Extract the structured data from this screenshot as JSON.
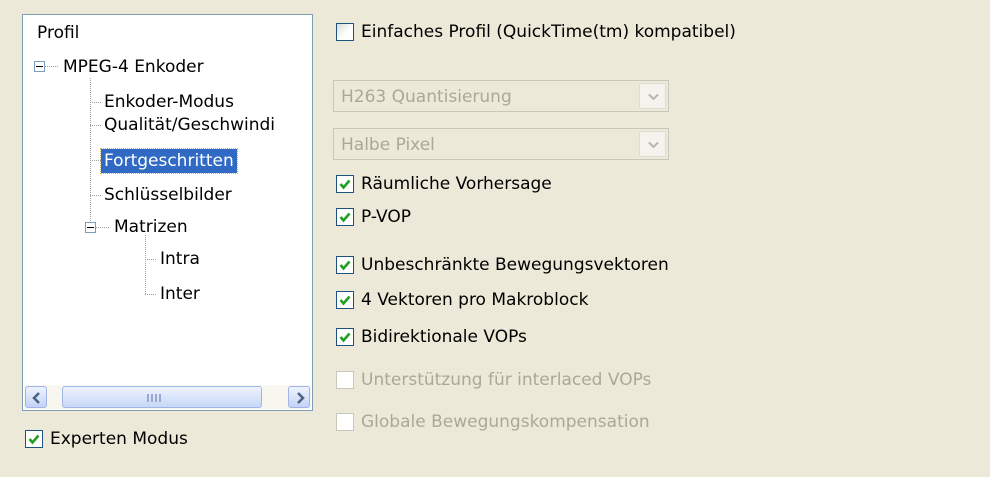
{
  "tree": {
    "nodes": [
      {
        "id": "profil",
        "label": "Profil"
      },
      {
        "id": "mpeg4",
        "label": "MPEG-4 Enkoder"
      },
      {
        "id": "enkoder_modus",
        "label": "Enkoder-Modus"
      },
      {
        "id": "qualitaet",
        "label": "Qualität/Geschwindi"
      },
      {
        "id": "fortgeschritten",
        "label": "Fortgeschritten",
        "selected": true
      },
      {
        "id": "schluesselbilder",
        "label": "Schlüsselbilder"
      },
      {
        "id": "matrizen",
        "label": "Matrizen"
      },
      {
        "id": "intra",
        "label": "Intra"
      },
      {
        "id": "inter",
        "label": "Inter"
      }
    ]
  },
  "expert_mode": {
    "label": "Experten Modus",
    "checked": true
  },
  "options": {
    "simple_profile": {
      "label": "Einfaches Profil (QuickTime(tm) kompatibel)",
      "checked": false,
      "enabled": true
    },
    "quantization": {
      "value": "H263 Quantisierung",
      "enabled": false
    },
    "pixel": {
      "value": "Halbe Pixel",
      "enabled": false
    },
    "spatial_prediction": {
      "label": "Räumliche Vorhersage",
      "checked": true,
      "enabled": true
    },
    "pvop": {
      "label": "P-VOP",
      "checked": true,
      "enabled": true
    },
    "unrestricted_mv": {
      "label": "Unbeschränkte Bewegungsvektoren",
      "checked": true,
      "enabled": true
    },
    "four_mv": {
      "label": "4 Vektoren pro Makroblock",
      "checked": true,
      "enabled": true
    },
    "bidirectional": {
      "label": "Bidirektionale VOPs",
      "checked": true,
      "enabled": true
    },
    "interlaced": {
      "label": "Unterstützung für interlaced VOPs",
      "checked": false,
      "enabled": false
    },
    "gmc": {
      "label": "Globale Bewegungskompensation",
      "checked": false,
      "enabled": false
    }
  },
  "colors": {
    "background": "#ece9d8",
    "selection": "#316ac5",
    "check": "#21a121",
    "disabled_text": "#aca899"
  }
}
